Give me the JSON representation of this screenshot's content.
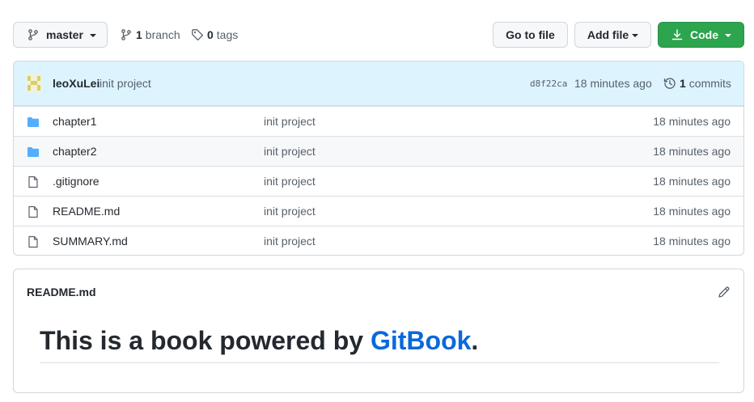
{
  "toolbar": {
    "branch_label": "master",
    "branch_count": "1",
    "branch_word": "branch",
    "tag_count": "0",
    "tag_word": "tags",
    "goto_file": "Go to file",
    "add_file": "Add file",
    "code": "Code",
    "code_color": "#2da44e"
  },
  "commit": {
    "author": "leoXuLei",
    "message": "init project",
    "sha": "d8f22ca",
    "time": "18 minutes ago",
    "count": "1",
    "count_word": "commits"
  },
  "files": [
    {
      "type": "folder",
      "icon": "folder-icon",
      "name": "chapter1",
      "message": "init project",
      "time": "18 minutes ago"
    },
    {
      "type": "folder",
      "icon": "folder-icon",
      "name": "chapter2",
      "message": "init project",
      "time": "18 minutes ago"
    },
    {
      "type": "file",
      "icon": "file-icon",
      "name": ".gitignore",
      "message": "init project",
      "time": "18 minutes ago"
    },
    {
      "type": "file",
      "icon": "file-icon",
      "name": "README.md",
      "message": "init project",
      "time": "18 minutes ago"
    },
    {
      "type": "file",
      "icon": "file-icon",
      "name": "SUMMARY.md",
      "message": "init project",
      "time": "18 minutes ago"
    }
  ],
  "readme": {
    "title": "README.md",
    "heading_prefix": "This is a book powered by ",
    "heading_link": "GitBook",
    "heading_suffix": ".",
    "link_color": "#0969da"
  }
}
